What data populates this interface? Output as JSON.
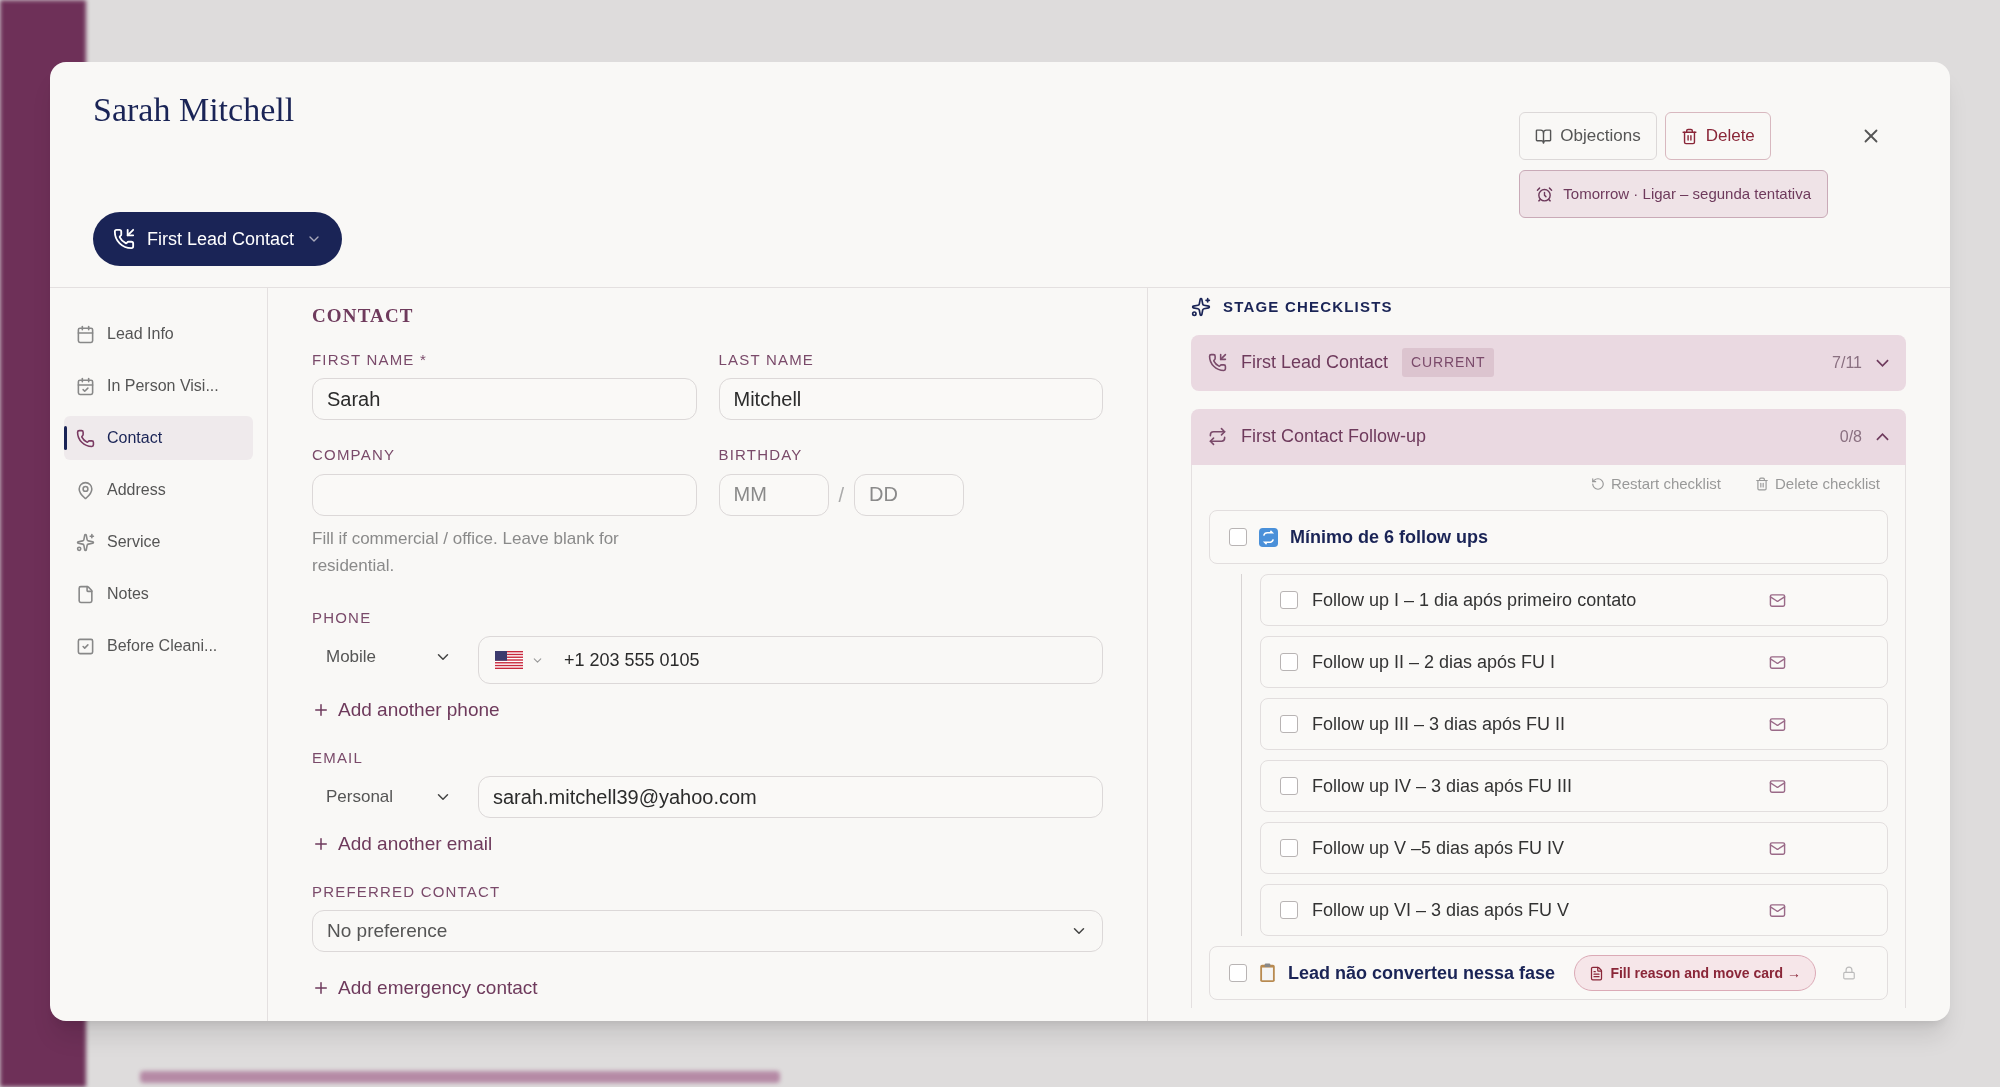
{
  "modal": {
    "title": "Sarah Mitchell",
    "stage_button": {
      "label": "First Lead Contact"
    },
    "actions": [
      {
        "kind": "objections",
        "label": "Objections"
      },
      {
        "kind": "delete",
        "label": "Delete"
      }
    ],
    "reminder": {
      "label": "Tomorrow · Ligar – segunda tentativa"
    }
  },
  "sidebar": {
    "items": [
      {
        "kind": "calendar",
        "label": "Lead Info",
        "selected": false
      },
      {
        "kind": "calendar-check",
        "label": "In Person Visi...",
        "selected": false
      },
      {
        "kind": "phone",
        "label": "Contact",
        "selected": true
      },
      {
        "kind": "pin",
        "label": "Address",
        "selected": false
      },
      {
        "kind": "sparkles",
        "label": "Service",
        "selected": false
      },
      {
        "kind": "note",
        "label": "Notes",
        "selected": false
      },
      {
        "kind": "check-square",
        "label": "Before Cleani...",
        "selected": false
      }
    ]
  },
  "contact": {
    "title": "CONTACT",
    "first_name": {
      "label": "FIRST NAME *",
      "value": "Sarah"
    },
    "last_name": {
      "label": "LAST NAME",
      "value": "Mitchell"
    },
    "company": {
      "label": "COMPANY",
      "hint": "Fill if commercial / office. Leave blank for residential."
    },
    "birthday": {
      "label": "BIRTHDAY",
      "month_placeholder": "MM",
      "separator": "/",
      "day_placeholder": "DD"
    },
    "phone": {
      "label": "PHONE",
      "type": "Mobile",
      "value": "+1 203 555 0105",
      "add": "Add another phone"
    },
    "email": {
      "label": "EMAIL",
      "type": "Personal",
      "value": "sarah.mitchell39@yahoo.com",
      "add": "Add another email"
    },
    "preferred_contact": {
      "label": "PREFERRED CONTACT",
      "value": "No preference"
    },
    "add_emergency": "Add emergency contact"
  },
  "checklists": {
    "title": "STAGE CHECKLISTS",
    "stages": [
      {
        "kind": "phone",
        "name": "First Lead Contact",
        "badge": "CURRENT",
        "count": "7/11",
        "expanded": false
      },
      {
        "kind": "repeat",
        "name": "First Contact Follow-up",
        "count": "0/8",
        "expanded": true,
        "actions": [
          {
            "kind": "restart",
            "label": "Restart checklist"
          },
          {
            "kind": "delete",
            "label": "Delete checklist"
          }
        ],
        "items": [
          {
            "kind": "group",
            "label": "Mínimo de 6 follow ups",
            "checked": false,
            "children": [
              {
                "label": "Follow up I – 1 dia após primeiro contato",
                "checked": false
              },
              {
                "label": "Follow up II – 2 dias após FU I",
                "checked": false
              },
              {
                "label": "Follow up III – 3 dias após FU II",
                "checked": false
              },
              {
                "label": "Follow up IV – 3 dias após FU III",
                "checked": false
              },
              {
                "label": "Follow up V –5 dias após FU IV",
                "checked": false
              },
              {
                "label": "Follow up VI – 3 dias após FU V",
                "checked": false
              }
            ]
          },
          {
            "kind": "action",
            "label": "Lead não converteu nessa fase",
            "checked": false,
            "action": "Fill reason and move card →",
            "locked": true
          }
        ]
      }
    ]
  }
}
